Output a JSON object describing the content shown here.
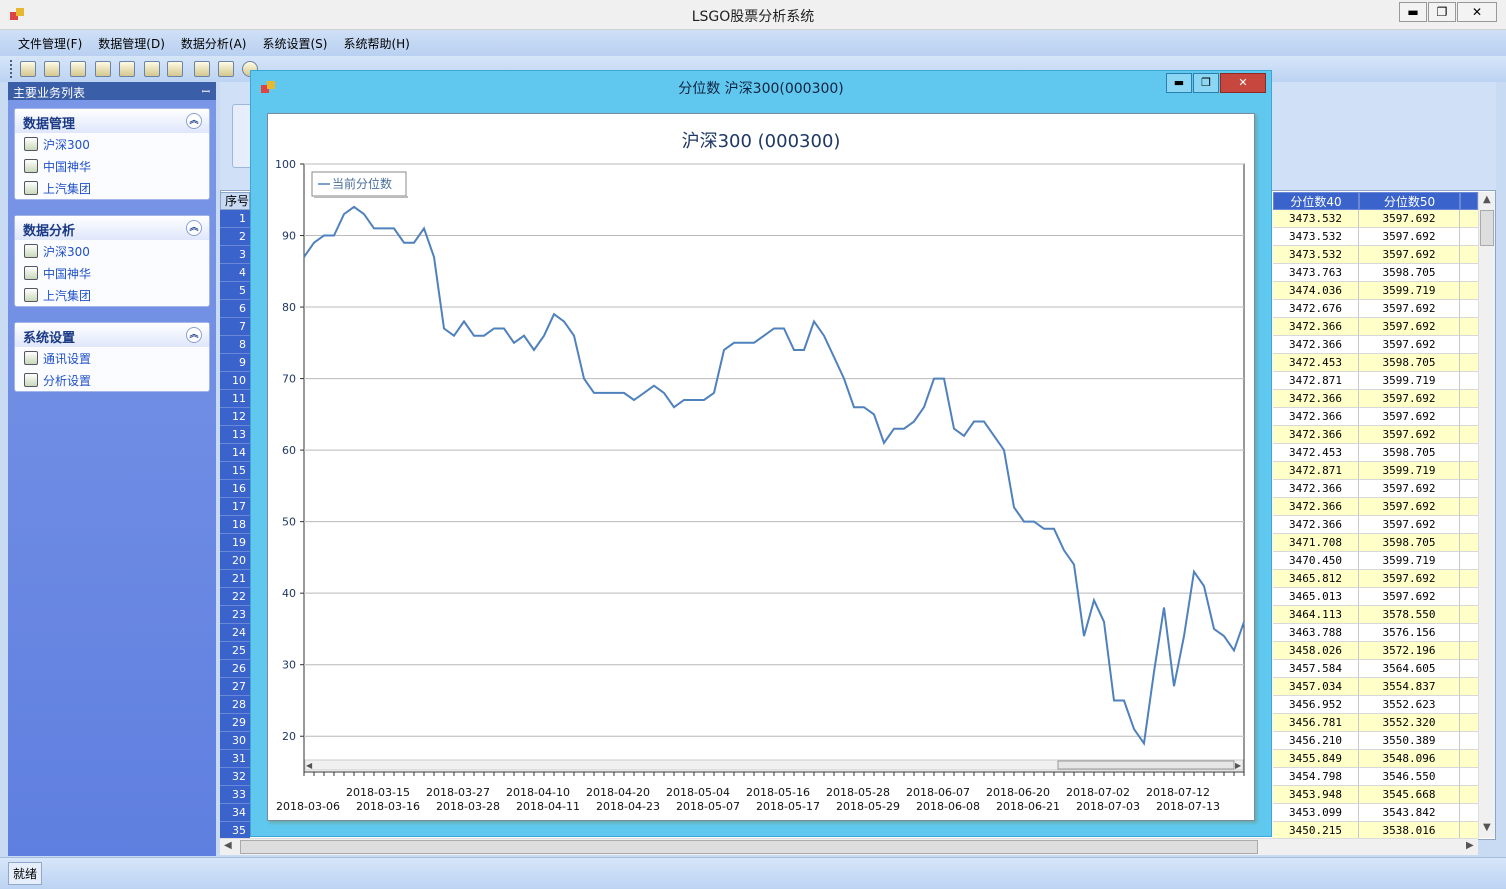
{
  "window": {
    "title": "LSGO股票分析系统",
    "min_label": "▬",
    "max_label": "❐",
    "close_label": "✕"
  },
  "menu": [
    "文件管理(F)",
    "数据管理(D)",
    "数据分析(A)",
    "系统设置(S)",
    "系统帮助(H)"
  ],
  "toolbar_icons": [
    "open-icon",
    "exit-icon",
    "import-icon",
    "add-icon",
    "tree-icon",
    "user-icon",
    "screen-icon",
    "help-icon",
    "folder-icon",
    "info-icon"
  ],
  "sidebar": {
    "header": "主要业务列表",
    "groups": [
      {
        "title": "数据管理",
        "items": [
          "沪深300",
          "中国神华",
          "上汽集团"
        ]
      },
      {
        "title": "数据分析",
        "items": [
          "沪深300",
          "中国神华",
          "上汽集团"
        ]
      },
      {
        "title": "系统设置",
        "items": [
          "通讯设置",
          "分析设置"
        ]
      }
    ]
  },
  "grid": {
    "row_header_label": "序号",
    "columns": [
      "分位数40",
      "分位数50"
    ],
    "row_numbers": [
      "1",
      "2",
      "3",
      "4",
      "5",
      "6",
      "7",
      "8",
      "9",
      "10",
      "11",
      "12",
      "13",
      "14",
      "15",
      "16",
      "17",
      "18",
      "19",
      "20",
      "21",
      "22",
      "23",
      "24",
      "25",
      "26",
      "27",
      "28",
      "29",
      "30",
      "31",
      "32",
      "33",
      "34",
      "35"
    ],
    "rows": [
      [
        "3473.532",
        "3597.692"
      ],
      [
        "3473.532",
        "3597.692"
      ],
      [
        "3473.532",
        "3597.692"
      ],
      [
        "3473.763",
        "3598.705"
      ],
      [
        "3474.036",
        "3599.719"
      ],
      [
        "3472.676",
        "3597.692"
      ],
      [
        "3472.366",
        "3597.692"
      ],
      [
        "3472.366",
        "3597.692"
      ],
      [
        "3472.453",
        "3598.705"
      ],
      [
        "3472.871",
        "3599.719"
      ],
      [
        "3472.366",
        "3597.692"
      ],
      [
        "3472.366",
        "3597.692"
      ],
      [
        "3472.366",
        "3597.692"
      ],
      [
        "3472.453",
        "3598.705"
      ],
      [
        "3472.871",
        "3599.719"
      ],
      [
        "3472.366",
        "3597.692"
      ],
      [
        "3472.366",
        "3597.692"
      ],
      [
        "3472.366",
        "3597.692"
      ],
      [
        "3471.708",
        "3598.705"
      ],
      [
        "3470.450",
        "3599.719"
      ],
      [
        "3465.812",
        "3597.692"
      ],
      [
        "3465.013",
        "3597.692"
      ],
      [
        "3464.113",
        "3578.550"
      ],
      [
        "3463.788",
        "3576.156"
      ],
      [
        "3458.026",
        "3572.196"
      ],
      [
        "3457.584",
        "3564.605"
      ],
      [
        "3457.034",
        "3554.837"
      ],
      [
        "3456.952",
        "3552.623"
      ],
      [
        "3456.781",
        "3552.320"
      ],
      [
        "3456.210",
        "3550.389"
      ],
      [
        "3455.849",
        "3548.096"
      ],
      [
        "3454.798",
        "3546.550"
      ],
      [
        "3453.948",
        "3545.668"
      ],
      [
        "3453.099",
        "3543.842"
      ],
      [
        "3450.215",
        "3538.016"
      ]
    ]
  },
  "status": "就绪",
  "child_window": {
    "title": "分位数 沪深300(000300)",
    "min_label": "▬",
    "max_label": "❐",
    "close_label": "✕"
  },
  "chart_data": {
    "type": "line",
    "title": "沪深300 (000300)",
    "legend": "当前分位数",
    "legend_position": "top-left",
    "ylim": [
      15,
      100
    ],
    "yticks": [
      20,
      30,
      40,
      50,
      60,
      70,
      80,
      90,
      100
    ],
    "grid": true,
    "x_tick_labels_row1": [
      "2018-03-15",
      "2018-03-27",
      "2018-04-10",
      "2018-04-20",
      "2018-05-04",
      "2018-05-16",
      "2018-05-28",
      "2018-06-07",
      "2018-06-20",
      "2018-07-02",
      "2018-07-12"
    ],
    "x_tick_labels_row2": [
      "2018-03-06",
      "2018-03-16",
      "2018-03-28",
      "2018-04-11",
      "2018-04-23",
      "2018-05-07",
      "2018-05-17",
      "2018-05-29",
      "2018-06-08",
      "2018-06-21",
      "2018-07-03",
      "2018-07-13"
    ],
    "series": [
      {
        "name": "当前分位数",
        "color": "#4f81bd",
        "values": [
          87,
          89,
          90,
          90,
          93,
          94,
          93,
          91,
          91,
          91,
          89,
          89,
          91,
          87,
          77,
          76,
          78,
          76,
          76,
          77,
          77,
          75,
          76,
          74,
          76,
          79,
          78,
          76,
          70,
          68,
          68,
          68,
          68,
          67,
          68,
          69,
          68,
          66,
          67,
          67,
          67,
          68,
          74,
          75,
          75,
          75,
          76,
          77,
          77,
          74,
          74,
          78,
          76,
          73,
          70,
          66,
          66,
          65,
          61,
          63,
          63,
          64,
          66,
          70,
          70,
          63,
          62,
          64,
          64,
          62,
          60,
          52,
          50,
          50,
          49,
          49,
          46,
          44,
          34,
          39,
          36,
          25,
          25,
          21,
          19,
          29,
          38,
          27,
          34,
          43,
          41,
          35,
          34,
          32,
          36
        ]
      }
    ]
  }
}
